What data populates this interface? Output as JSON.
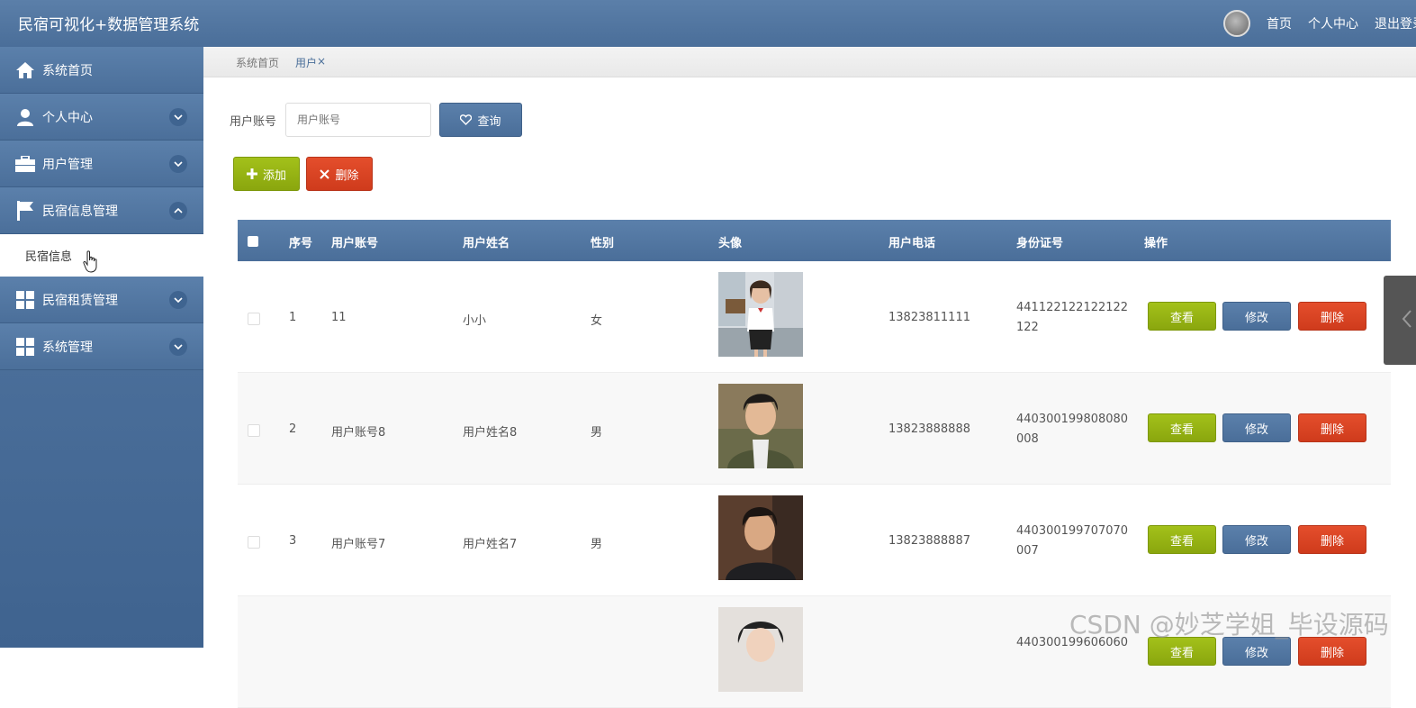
{
  "header": {
    "app_title": "民宿可视化+数据管理系统",
    "nav": [
      "首页",
      "个人中心",
      "退出登录"
    ]
  },
  "sidebar": {
    "items": [
      {
        "label": "系统首页",
        "icon": "home-icon"
      },
      {
        "label": "个人中心",
        "icon": "user-icon"
      },
      {
        "label": "用户管理",
        "icon": "briefcase-icon"
      },
      {
        "label": "民宿信息管理",
        "icon": "flag-icon"
      },
      {
        "label": "民宿租赁管理",
        "icon": "grid-icon"
      },
      {
        "label": "系统管理",
        "icon": "grid-icon"
      }
    ],
    "submenu": [
      "民宿信息"
    ]
  },
  "breadcrumb": [
    "系统首页",
    "用户",
    "×"
  ],
  "search": {
    "label": "用户账号",
    "placeholder": "用户账号",
    "button": "查询"
  },
  "toolbar": {
    "add": "添加",
    "delete": "删除"
  },
  "table": {
    "columns": [
      "序号",
      "用户账号",
      "用户姓名",
      "性别",
      "头像",
      "用户电话",
      "身份证号",
      "操作"
    ],
    "rows": [
      {
        "no": "1",
        "account": "11",
        "name": "小小",
        "gender": "女",
        "phone": "13823811111",
        "id_number": "441122122122122122"
      },
      {
        "no": "2",
        "account": "用户账号8",
        "name": "用户姓名8",
        "gender": "男",
        "phone": "13823888888",
        "id_number": "440300199808080008"
      },
      {
        "no": "3",
        "account": "用户账号7",
        "name": "用户姓名7",
        "gender": "男",
        "phone": "13823888887",
        "id_number": "440300199707070007"
      },
      {
        "no": "",
        "account": "",
        "name": "",
        "gender": "",
        "phone": "",
        "id_number": "440300199606060"
      }
    ],
    "actions": [
      "查看",
      "修改",
      "删除"
    ]
  },
  "watermark": "CSDN @妙芝学姐_毕设源码",
  "colors": {
    "primary": "#4a6e99",
    "success": "#94b314",
    "danger": "#d9411f"
  }
}
